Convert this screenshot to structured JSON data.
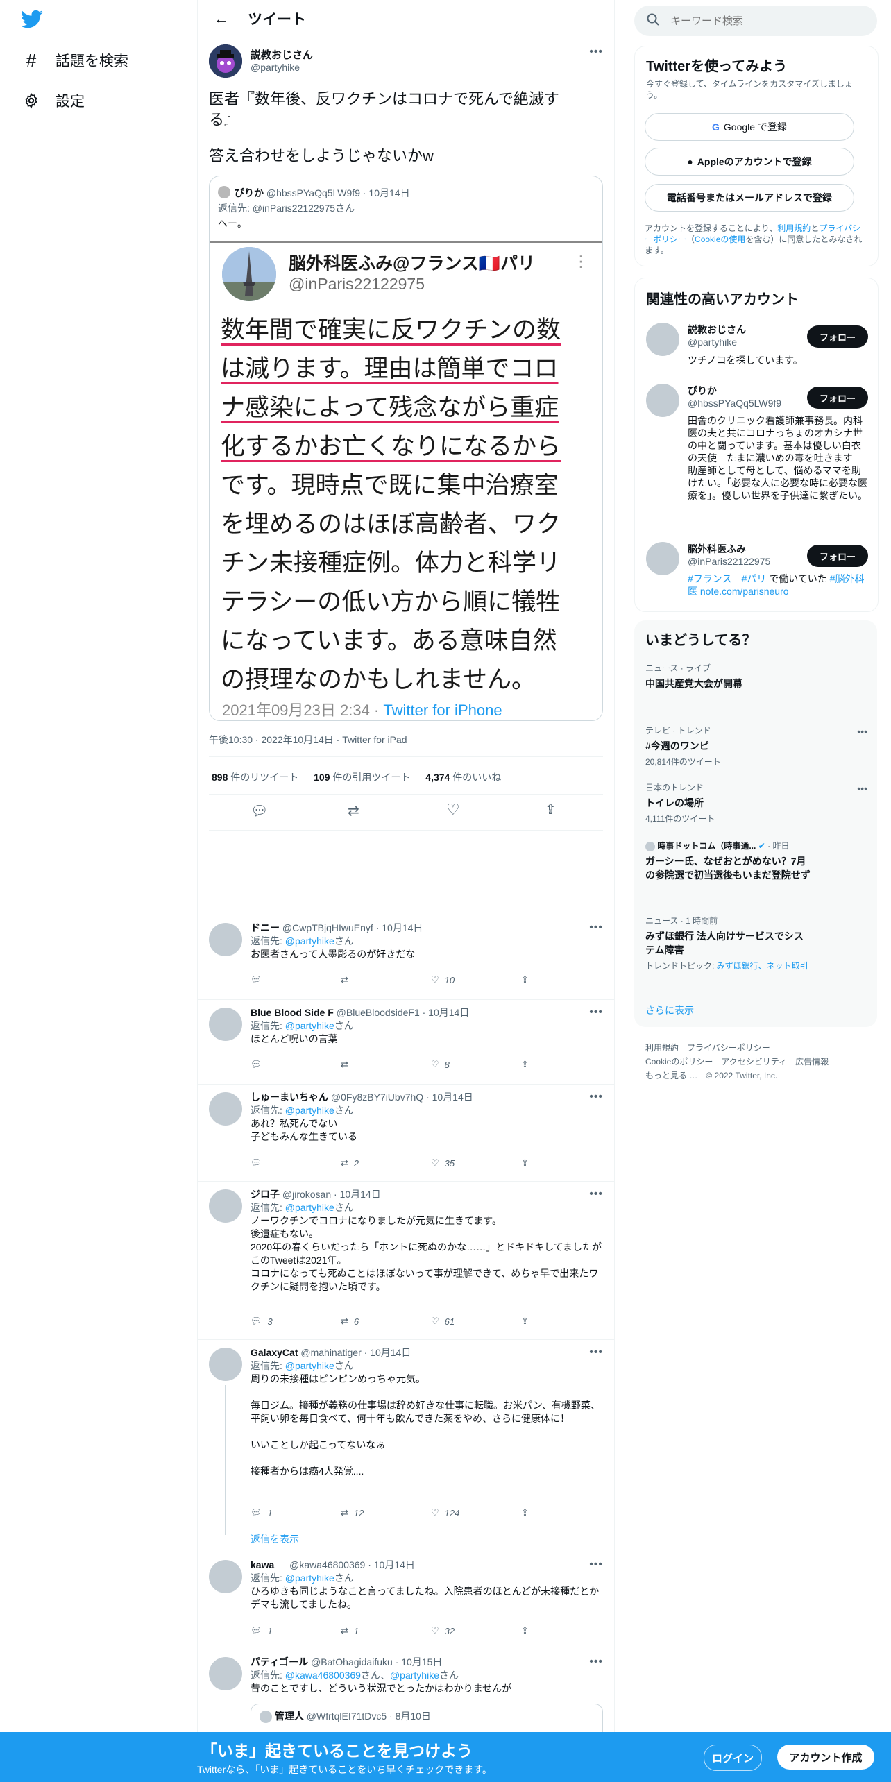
{
  "nav": {
    "explore": "話題を検索",
    "settings": "設定"
  },
  "header": {
    "title": "ツイート"
  },
  "tweet": {
    "author_name": "説教おじさん",
    "author_handle": "@partyhike",
    "text_line1": "医者『数年後、反ワクチンはコロナで死んで絶滅す",
    "text_line2": "る』",
    "text_line3": "答え合わせをしようじゃないかw",
    "quote": {
      "name": "ぴりか",
      "handle": "@hbssPYaQq5LW9f9",
      "date": "· 10月14日",
      "reply_to": "返信先: @inParis22122975さん",
      "text": "へー。",
      "embed": {
        "name": "脳外科医ふみ@フランス🇫🇷パリ",
        "handle": "@inParis22122975",
        "lines": [
          "数年間で確実に反ワクチンの数",
          "は減ります。理由は簡単でコロ",
          "ナ感染によって残念ながら重症",
          "化するかお亡くなりになるから",
          "です。現時点で既に集中治療室",
          "を埋めるのはほぼ高齢者、ワク",
          "チン未接種症例。体力と科学リ",
          "テラシーの低い方から順に犠牲",
          "になっています。ある意味自然",
          "の摂理なのかもしれません。"
        ],
        "footer_date": "2021年09月23日 2:34 · ",
        "footer_source": "Twitter for iPhone"
      }
    },
    "meta": "午後10:30 · 2022年10月14日 · Twitter for iPad",
    "retweets_count": "898",
    "retweets_label": " 件のリツイート",
    "quotes_count": "109",
    "quotes_label": " 件の引用ツイート",
    "likes_count": "4,374",
    "likes_label": " 件のいいね"
  },
  "replies": [
    {
      "name": "ドニー",
      "handle": "@CwpTBjqHIwuEnyf",
      "date": "· 10月14日",
      "reply_prefix": "返信先: ",
      "reply_to": "@partyhike",
      "reply_suffix": "さん",
      "text": "お医者さんって人墨彫るのが好きだな",
      "replies": "",
      "retweets": "",
      "likes": "10"
    },
    {
      "name": "Blue Blood Side F",
      "handle": "@BlueBloodsideF1",
      "date": "· 10月14日",
      "reply_prefix": "返信先: ",
      "reply_to": "@partyhike",
      "reply_suffix": "さん",
      "text": "ほとんど呪いの言葉",
      "replies": "",
      "retweets": "",
      "likes": "8"
    },
    {
      "name": "しゅーまいちゃん",
      "handle": "@0Fy8zBY7iUbv7hQ",
      "date": "· 10月14日",
      "reply_prefix": "返信先: ",
      "reply_to": "@partyhike",
      "reply_suffix": "さん",
      "text": "あれ？私死んでない\n子どもみんな生きている",
      "replies": "",
      "retweets": "2",
      "likes": "35"
    },
    {
      "name": "ジロ子",
      "handle": "@jirokosan",
      "date": "· 10月14日",
      "reply_prefix": "返信先: ",
      "reply_to": "@partyhike",
      "reply_suffix": "さん",
      "text": "ノーワクチンでコロナになりましたが元気に生きてます。\n後遺症もない。\n2020年の春くらいだったら「ホントに死ぬのかな……」とドキドキしてましたがこのTweetは2021年。\nコロナになっても死ぬことはほぼないって事が理解できて、めちゃ早で出来たワクチンに疑問を抱いた頃です。",
      "replies": "3",
      "retweets": "6",
      "likes": "61"
    },
    {
      "name": "GalaxyCat",
      "handle": "@mahinatiger",
      "date": "· 10月14日",
      "reply_prefix": "返信先: ",
      "reply_to": "@partyhike",
      "reply_suffix": "さん",
      "text": "周りの未接種はピンピンめっちゃ元気。\n\n毎日ジム。接種が義務の仕事場は辞め好きな仕事に転職。お米パン、有機野菜、平飼い卵を毎日食べて、何十年も飲んできた薬をやめ、さらに健康体に！\n\nいいことしか起こってないなぁ\n\n接種者からは癌4人発覚....",
      "replies": "1",
      "retweets": "12",
      "likes": "124",
      "show_replies": "返信を表示"
    },
    {
      "name": "kawa",
      "handle": "@kawa46800369",
      "date": "· 10月14日",
      "reply_prefix": "返信先: ",
      "reply_to": "@partyhike",
      "reply_suffix": "さん",
      "text": "ひろゆきも同じようなこと言ってましたね。入院患者のほとんどが未接種だとかデマも流してましたね。",
      "replies": "1",
      "retweets": "1",
      "likes": "32"
    },
    {
      "name": "パティゴール",
      "handle": "@BatOhagidaifuku",
      "date": "· 10月15日",
      "reply_prefix": "返信先: ",
      "reply_to": "@kawa46800369",
      "reply_to2": "@partyhike",
      "reply_mid": "さん、",
      "reply_suffix": "さん",
      "text": "昔のことですし、どういう状況でとったかはわかりませんが",
      "quote_name": "管理人",
      "quote_handle": "@WfrtqlEI71tDvc5 · 8月10日"
    }
  ],
  "right": {
    "search_placeholder": "キーワード検索",
    "signup": {
      "title": "Twitterを使ってみよう",
      "subtitle": "今すぐ登録して、タイムラインをカスタマイズしましょう。",
      "google": "Google で登録",
      "apple": "Appleのアカウントで登録",
      "phone": "電話番号またはメールアドレスで登録",
      "terms_a": "アカウントを登録することにより、",
      "terms_link1": "利用規約",
      "terms_b": "と",
      "terms_link2": "プライバシーポリシー",
      "terms_c": "（",
      "terms_link3": "Cookieの使用",
      "terms_d": "を含む）に同意したとみなされます。"
    },
    "related": {
      "title": "関連性の高いアカウント",
      "follow": "フォロー",
      "accounts": [
        {
          "name": "説教おじさん",
          "handle": "@partyhike",
          "bio": "ツチノコを探しています。"
        },
        {
          "name": "ぴりか",
          "handle": "@hbssPYaQq5LW9f9",
          "bio": "田舎のクリニック看護師兼事務長。内科医の夫と共にコロナっちょのオカシナ世の中と闘っています。基本は優しい白衣の天使　たまに濃いめの毒を吐きます　助産師として母として、悩めるママを助けたい。「必要な人に必要な時に必要な医療を」。優しい世界を子供達に繋ぎたい。"
        },
        {
          "name": "脳外科医ふみ",
          "handle": "@inParis22122975",
          "bio_a": "#フランス",
          "bio_b": "#パリ",
          "bio_c": " で働いていた ",
          "bio_d": "#脳外科医",
          "bio_e": "note.com/parisneuro"
        }
      ]
    },
    "trends": {
      "title": "いまどうしてる？",
      "items": [
        {
          "meta": "ニュース · ライブ",
          "title": "中国共産党大会が開幕"
        },
        {
          "meta": "テレビ · トレンド",
          "title": "#今週のワンピ",
          "count": "20,814件のツイート"
        },
        {
          "meta": "日本のトレンド",
          "title": "トイレの場所",
          "count": "4,111件のツイート"
        },
        {
          "meta": "時事ドットコム（時事通...",
          "meta_date": "· 昨日",
          "title": "ガーシー氏、なぜおとがめない？7月の参院選で初当選後もいまだ登院せず"
        },
        {
          "meta": "ニュース · 1 時間前",
          "title": "みずほ銀行 法人向けサービスでシステム障害",
          "topic_prefix": "トレンドトピック: ",
          "topic": "みずほ銀行、ネット取引"
        }
      ],
      "more": "さらに表示"
    },
    "footer": {
      "terms": "利用規約",
      "privacy": "プライバシーポリシー",
      "cookie": "Cookieのポリシー",
      "access": "アクセシビリティ",
      "ads": "広告情報",
      "more": "もっと見る …",
      "copy": "© 2022 Twitter, Inc."
    }
  },
  "bottom": {
    "title": "「いま」起きていることを見つけよう",
    "subtitle": "Twitterなら、「いま」起きていることをいち早くチェックできます。",
    "login": "ログイン",
    "signup": "アカウント作成"
  },
  "colors": {
    "accent": "#1d9bf0",
    "text": "#0f1419",
    "muted": "#536471",
    "underline": "#e0245e"
  }
}
